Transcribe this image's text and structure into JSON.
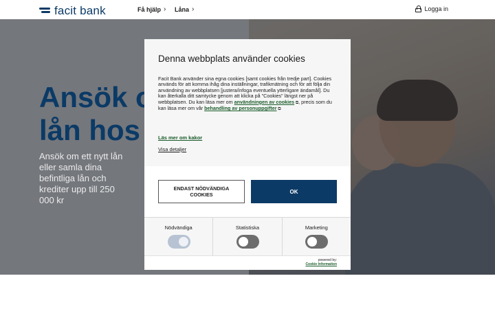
{
  "header": {
    "logo_text": "facit bank",
    "nav": [
      {
        "label": "Få hjälp"
      },
      {
        "label": "Låna"
      }
    ],
    "login_label": "Logga in"
  },
  "hero": {
    "title_line1": "Ansök o",
    "title_line2": "lån hos",
    "text": "Ansök om ett nytt lån eller samla dina befintliga lån och krediter upp till 250 000 kr"
  },
  "cookie_dialog": {
    "title": "Denna webbplats använder cookies",
    "body_part1": "Facit Bank använder sina egna cookies [samt cookies från tredje part]. Cookies används för att komma ihåg dina inställningar, trafikmätning och för att följa din användning av webbplatsen [justera/infoga eventuella ytterligare ändamål]. Du kan återkalla ditt samtycke genom att klicka på \"Cookies\" längst ner på webbplatsen. Du kan läsa mer om ",
    "link_usage": "användningen av cookies",
    "body_part2": ", precis som du kan läsa mer om vår ",
    "link_privacy": "behandling av personuppgifter",
    "read_more": "Läs mer om kakor",
    "show_details": "Visa detaljer",
    "btn_necessary": "ENDAST NÖDVÄNDIGA COOKIES",
    "btn_ok": "OK",
    "toggles": [
      {
        "label": "Nödvändiga",
        "state": "on-disabled"
      },
      {
        "label": "Statistiska",
        "state": "off"
      },
      {
        "label": "Marketing",
        "state": "off"
      }
    ],
    "powered_by": "powered by:",
    "powered_brand": "Cookie Information"
  },
  "colors": {
    "brand_navy": "#0b3a66",
    "link_green": "#1a5c2a",
    "overlay": "rgba(40,44,50,0.62)"
  }
}
